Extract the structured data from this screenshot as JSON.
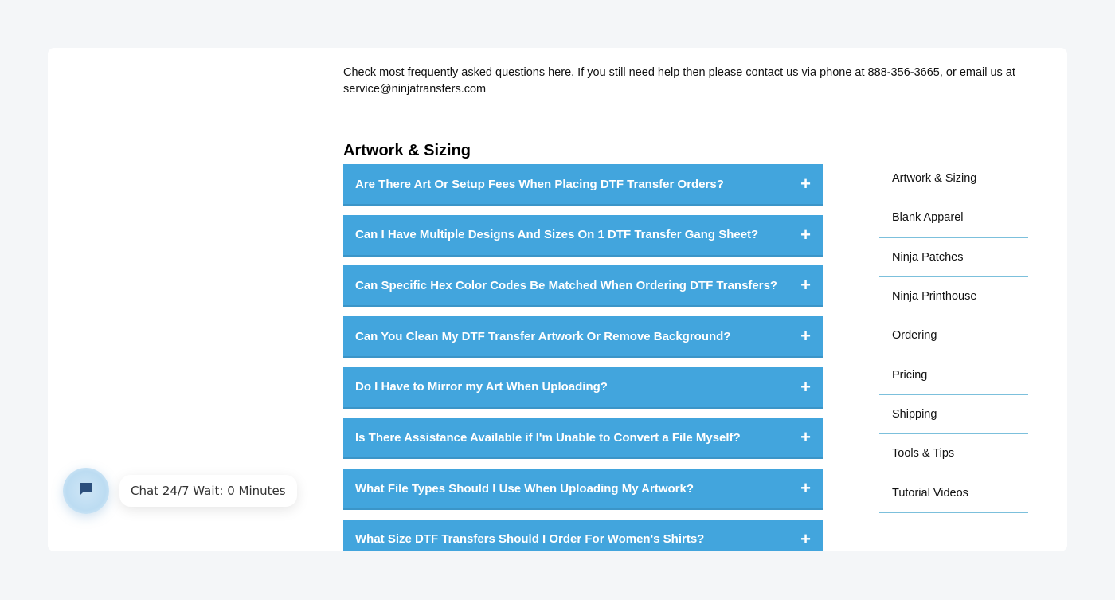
{
  "intro_text": "Check most frequently asked questions here. If you still need help then please contact us via phone at 888-356-3665, or email us at service@ninjatransfers.com",
  "section": {
    "title": "Artwork & Sizing",
    "faqs": [
      {
        "question": "Are There Art Or Setup Fees When Placing DTF Transfer Orders?",
        "icon": "+"
      },
      {
        "question": "Can I Have Multiple Designs And Sizes On 1 DTF Transfer Gang Sheet?",
        "icon": "+"
      },
      {
        "question": "Can Specific Hex Color Codes Be Matched When Ordering DTF Transfers?",
        "icon": "+"
      },
      {
        "question": "Can You Clean My DTF Transfer Artwork Or Remove Background?",
        "icon": "+"
      },
      {
        "question": "Do I Have to Mirror my Art When Uploading?",
        "icon": "+"
      },
      {
        "question": "Is There Assistance Available if I'm Unable to Convert a File Myself?",
        "icon": "+"
      },
      {
        "question": "What File Types Should I Use When Uploading My Artwork?",
        "icon": "+"
      },
      {
        "question": "What Size DTF Transfers Should I Order For Women's Shirts?",
        "icon": "+"
      }
    ]
  },
  "side_nav": {
    "items": [
      {
        "label": "Artwork & Sizing"
      },
      {
        "label": "Blank Apparel"
      },
      {
        "label": "Ninja Patches"
      },
      {
        "label": "Ninja Printhouse"
      },
      {
        "label": "Ordering"
      },
      {
        "label": "Pricing"
      },
      {
        "label": "Shipping"
      },
      {
        "label": "Tools & Tips"
      },
      {
        "label": "Tutorial Videos"
      }
    ]
  },
  "chat": {
    "label": "Chat 24/7 Wait: 0 Minutes",
    "icon": "chat-bubble-icon"
  },
  "colors": {
    "accent": "#42a5dd",
    "divider": "#7cc0dc",
    "chat_icon": "#2c4f7c"
  }
}
